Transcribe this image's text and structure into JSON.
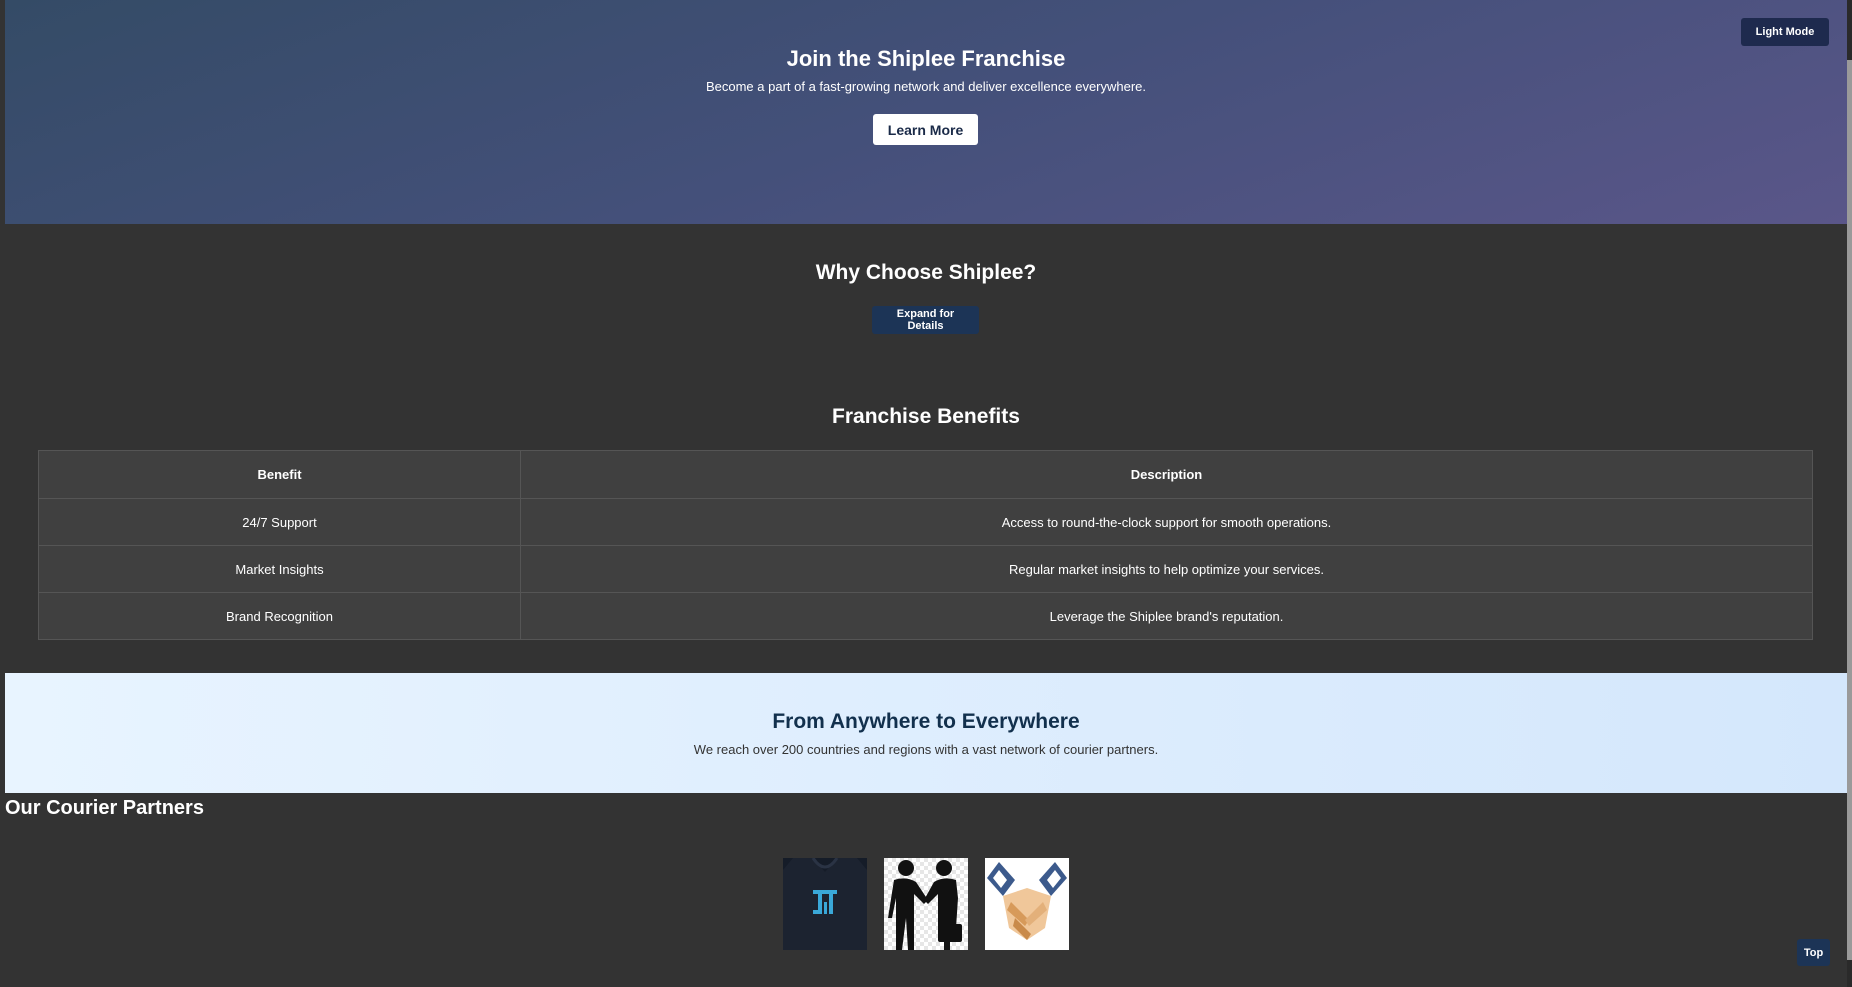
{
  "hero": {
    "title": "Join the Shiplee Franchise",
    "subtitle": "Become a part of a fast-growing network and deliver excellence everywhere.",
    "cta_label": "Learn More",
    "mode_toggle_label": "Light Mode"
  },
  "why": {
    "title": "Why Choose Shiplee?",
    "expand_label": "Expand for Details"
  },
  "benefits": {
    "title": "Franchise Benefits",
    "headers": [
      "Benefit",
      "Description"
    ],
    "rows": [
      {
        "benefit": "24/7 Support",
        "description": "Access to round-the-clock support for smooth operations."
      },
      {
        "benefit": "Market Insights",
        "description": "Regular market insights to help optimize your services."
      },
      {
        "benefit": "Brand Recognition",
        "description": "Leverage the Shiplee brand's reputation."
      }
    ]
  },
  "anywhere": {
    "title": "From Anywhere to Everywhere",
    "subtitle": "We reach over 200 countries and regions with a vast network of courier partners."
  },
  "partners": {
    "title": "Our Courier Partners",
    "logos": [
      {
        "icon": "partner-logo-dark-tee-icon"
      },
      {
        "icon": "partner-logo-businessmen-handshake-icon"
      },
      {
        "icon": "partner-logo-handshake-icon"
      }
    ]
  },
  "top_button_label": "Top",
  "colors": {
    "page_bg": "#333333",
    "hero_start": "#344b66",
    "hero_end": "#5a5689",
    "button_dark": "#1c3456",
    "banner_light": "#e8f4ff"
  }
}
